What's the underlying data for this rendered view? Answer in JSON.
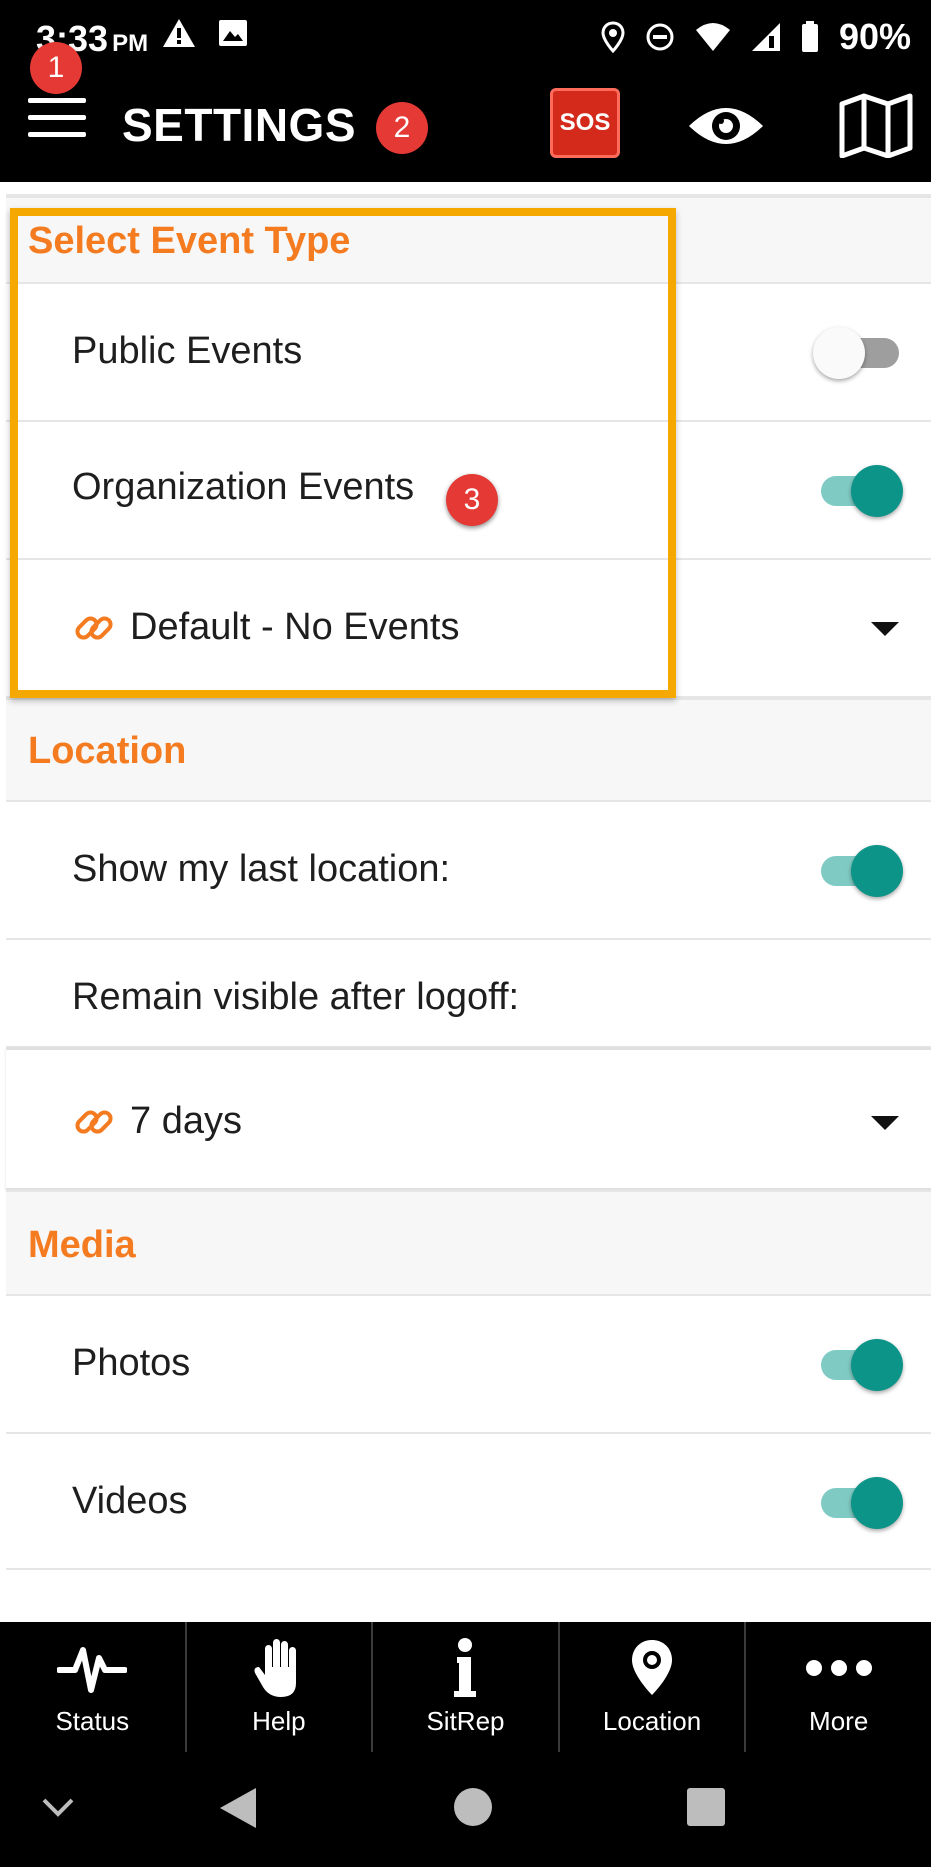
{
  "status_bar": {
    "time": "3:33",
    "ampm": "PM",
    "battery": "90%"
  },
  "app_bar": {
    "title": "SETTINGS",
    "sos_label": "SOS"
  },
  "annotations": [
    "1",
    "2",
    "3"
  ],
  "sections": {
    "event_type": {
      "header": "Select Event Type",
      "public_events": {
        "label": "Public Events",
        "on": false
      },
      "organization_events": {
        "label": "Organization Events",
        "on": true
      },
      "dropdown_value": "Default - No Events"
    },
    "location": {
      "header": "Location",
      "show_last_location": {
        "label": "Show my last location:",
        "on": true
      },
      "remain_visible_label": "Remain visible after logoff:",
      "remain_visible_value": "7 days"
    },
    "media": {
      "header": "Media",
      "photos": {
        "label": "Photos",
        "on": true
      },
      "videos": {
        "label": "Videos",
        "on": true
      }
    }
  },
  "bottom_nav": {
    "items": [
      {
        "label": "Status",
        "icon": "heartbeat-icon"
      },
      {
        "label": "Help",
        "icon": "hand-icon"
      },
      {
        "label": "SitRep",
        "icon": "info-icon"
      },
      {
        "label": "Location",
        "icon": "location-pin-icon"
      },
      {
        "label": "More",
        "icon": "more-dots-icon"
      }
    ]
  },
  "colors": {
    "accent_orange": "#f47b20",
    "toggle_on": "#0d9488",
    "highlight_border": "#f5a800",
    "badge_red": "#e53935",
    "sos_red": "#d42a1c"
  }
}
